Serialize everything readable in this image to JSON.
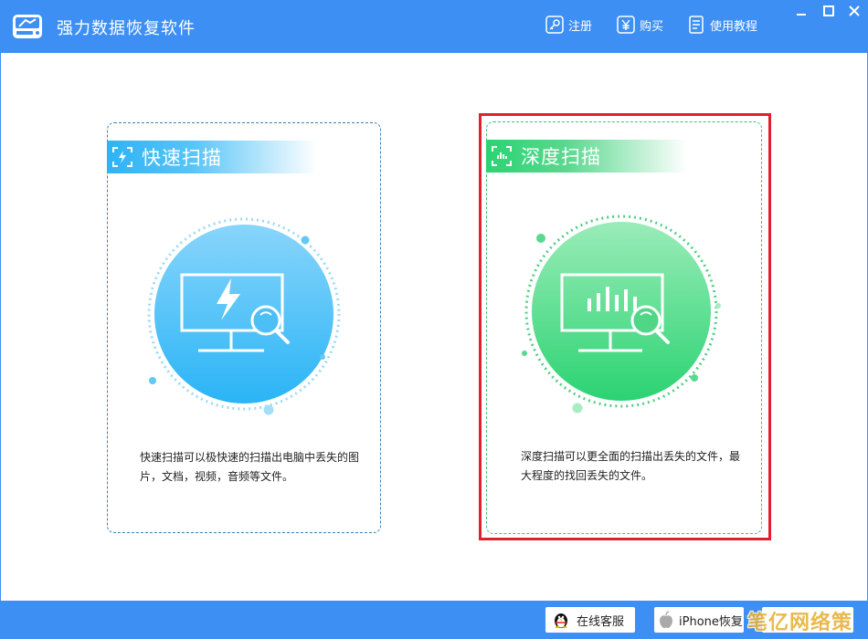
{
  "app": {
    "title": "强力数据恢复软件",
    "icon": "hard-drive-icon"
  },
  "header": {
    "register_label": "注册",
    "buy_label": "购买",
    "tutorial_label": "使用教程"
  },
  "window_controls": [
    "minimize-icon",
    "maximize-icon",
    "close-icon"
  ],
  "cards": {
    "quick": {
      "title": "快速扫描",
      "icon": "lightning-frame-icon",
      "hero_icon": "monitor-lightning-search-icon",
      "description": "快速扫描可以极快速的扫描出电脑中丢失的图片，文档，视频，音频等文件。",
      "accent": "#2eb3f5"
    },
    "deep": {
      "title": "深度扫描",
      "icon": "bars-frame-icon",
      "hero_icon": "monitor-chart-search-icon",
      "description": "深度扫描可以更全面的扫描出丢失的文件，最大程度的找回丢失的文件。",
      "accent": "#2bd372",
      "selected": true,
      "selection_color": "#e0202a"
    }
  },
  "footer": {
    "service_label": "在线客服",
    "iphone_label": "iPhone恢复",
    "watermark": "笔亿网络策划"
  },
  "colors": {
    "titlebar": "#3d8ff4",
    "quick_border": "#3d7fb5",
    "deep_border": "#3ec27a"
  }
}
